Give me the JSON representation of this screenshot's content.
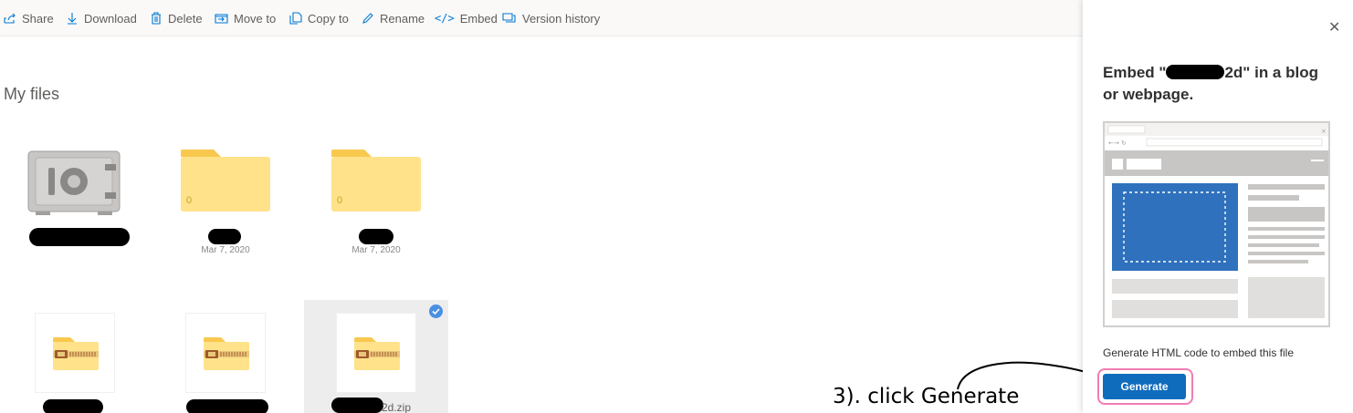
{
  "toolbar": {
    "share": "Share",
    "download": "Download",
    "delete": "Delete",
    "move_to": "Move to",
    "copy_to": "Copy to",
    "rename": "Rename",
    "embed": "Embed",
    "version_history": "Version history"
  },
  "page": {
    "title": "My files"
  },
  "files": {
    "folder1": {
      "count": "0",
      "date": "Mar 7, 2020"
    },
    "folder2": {
      "count": "0",
      "date": "Mar 7, 2020"
    },
    "zip3_suffix": "2d.zip"
  },
  "annotation": "3). click Generate",
  "panel": {
    "title_prefix": "Embed \"",
    "title_suffix": "2d\" in a blog or webpage.",
    "description": "Generate HTML code to embed this file",
    "generate_label": "Generate",
    "close_glyph": "✕"
  },
  "colors": {
    "accent": "#0f6cbd",
    "folder": "#ffe28a",
    "highlight_ring": "#f27cb4"
  }
}
